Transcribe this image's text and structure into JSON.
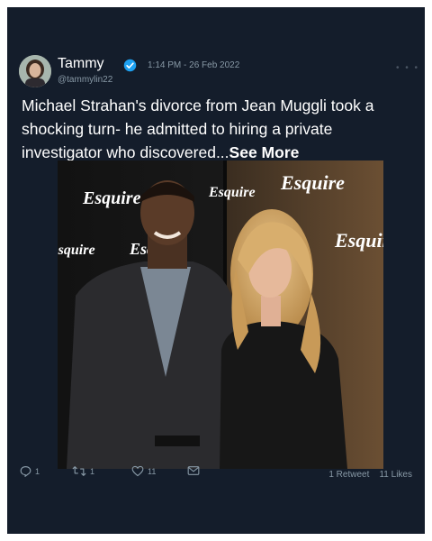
{
  "tweet": {
    "author_name": "Tammy",
    "author_handle": "@tammylin22",
    "timestamp": "1:14 PM - 26 Feb 2022",
    "text": "Michael Strahan's divorce from Jean Muggli took a shocking turn- he admitted to hiring a private investigator who discovered...",
    "see_more_label": "See More",
    "more_label": "• • •",
    "image_text": "Esquire"
  },
  "actions": {
    "reply_count": "1",
    "retweet_count": "1",
    "like_count": "11"
  },
  "summary": {
    "retweets_text": "1 Retweet",
    "likes_text": "11 Likes"
  },
  "colors": {
    "card_bg": "#141d2b",
    "muted": "#8899a6",
    "verified": "#1da1f2"
  },
  "icons": [
    "verified-badge-icon",
    "reply-icon",
    "retweet-icon",
    "like-icon",
    "share-icon",
    "more-icon"
  ]
}
